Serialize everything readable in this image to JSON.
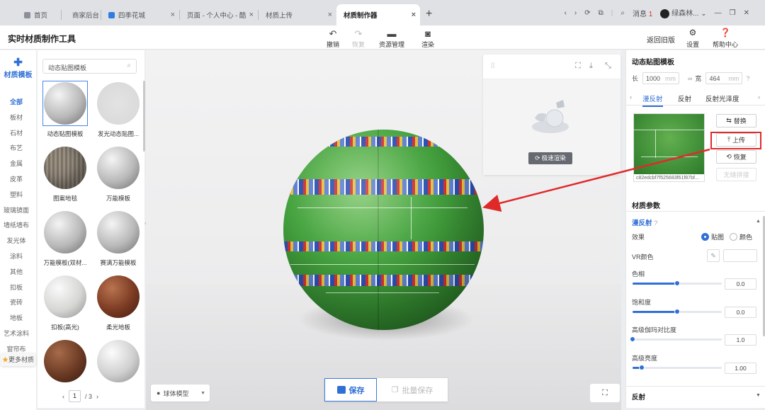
{
  "browser": {
    "tabs": [
      {
        "label": "首页"
      },
      {
        "label": "商家后台"
      },
      {
        "label": "四季花城"
      },
      {
        "label": "页面 - 个人中心 - 酷"
      },
      {
        "label": "材质上传"
      },
      {
        "label": "材质制作器"
      }
    ],
    "new_tab": "+",
    "message_label": "消息",
    "message_count": "1",
    "user_name": "绿森林..."
  },
  "header": {
    "title": "实时材质制作工具",
    "undo": "撤销",
    "redo": "恢复",
    "asset_manage": "资源管理",
    "render": "渲染",
    "revert_old": "返回旧版",
    "settings": "设置",
    "help": "帮助中心"
  },
  "rail": {
    "title": "材质模板",
    "items": [
      "全部",
      "板材",
      "石材",
      "布艺",
      "金属",
      "皮革",
      "塑料",
      "玻璃镜面",
      "墙纸墙布",
      "发光体",
      "涂料",
      "其他",
      "扣板",
      "瓷砖",
      "地板",
      "艺术涂料",
      "窗帘布"
    ],
    "more": "更多材质"
  },
  "materials": {
    "search_value": "动态贴图模板",
    "items": [
      {
        "name": "动态贴图模板"
      },
      {
        "name": "发光动态贴图..."
      },
      {
        "name": "图案地毯"
      },
      {
        "name": "万能模板"
      },
      {
        "name": "万能模板(双材..."
      },
      {
        "name": "赛满万能模板"
      },
      {
        "name": "扣板(高光)"
      },
      {
        "name": "柔光地板"
      },
      {
        "name": ""
      },
      {
        "name": ""
      }
    ],
    "page_current": "1",
    "page_total": "/ 3"
  },
  "viewport": {
    "quick_render": "极速渲染",
    "model_select": "球体模型",
    "save": "保存",
    "batch_save": "批量保存"
  },
  "properties": {
    "template_name": "动态贴图模板",
    "length_label": "长",
    "length_value": "1000",
    "width_label": "宽",
    "width_value": "464",
    "unit": "mm",
    "tabs": [
      "漫反射",
      "反射",
      "反射光泽度"
    ],
    "texture_filename": "c82edcbf7f525683f61f87bf...",
    "replace": "替换",
    "upload": "上传",
    "restore": "恢复",
    "seamless": "无缝拼接",
    "section_title": "材质参数",
    "sub_title": "漫反射",
    "effect_label": "效果",
    "effect_options": [
      "贴图",
      "颜色"
    ],
    "effect_selected": "贴图",
    "vr_color_label": "VR颜色",
    "sliders": [
      {
        "label": "色相",
        "value": "0.0",
        "level": 0.5
      },
      {
        "label": "饱和度",
        "value": "0.0",
        "level": 0.5
      },
      {
        "label": "高级伽玛对比度",
        "value": "1.0",
        "level": 0.0
      },
      {
        "label": "高级亮度",
        "value": "1.00",
        "level": 0.1
      }
    ],
    "reflect_title": "反射"
  },
  "colors": {
    "accent": "#2f6fd6",
    "highlight": "#e02a2a"
  }
}
